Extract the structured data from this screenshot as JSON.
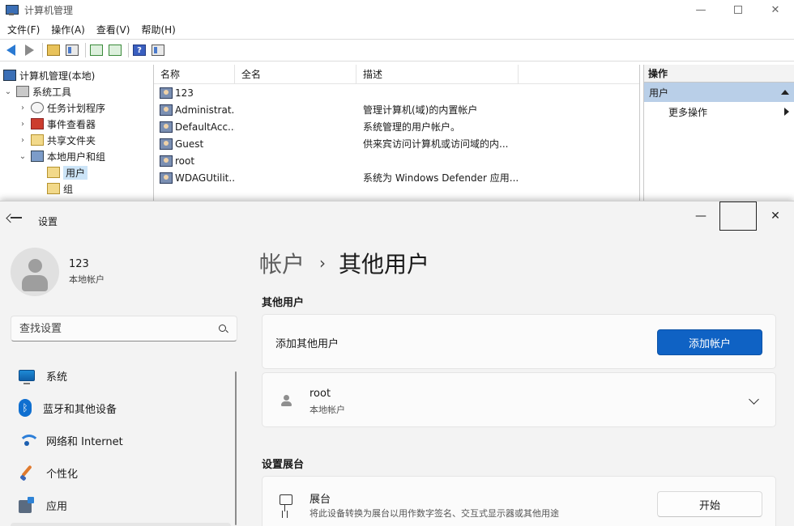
{
  "mmc": {
    "title": "计算机管理",
    "menu": [
      "文件(F)",
      "操作(A)",
      "查看(V)",
      "帮助(H)"
    ],
    "tree": [
      {
        "label": "计算机管理(本地)",
        "expander": "",
        "icon": "computer-icon"
      },
      {
        "label": "系统工具",
        "expander": "⌄",
        "icon": "tools-icon"
      },
      {
        "label": "任务计划程序",
        "expander": "›",
        "icon": "clock-icon"
      },
      {
        "label": "事件查看器",
        "expander": "›",
        "icon": "event-viewer-icon"
      },
      {
        "label": "共享文件夹",
        "expander": "›",
        "icon": "folder-icon"
      },
      {
        "label": "本地用户和组",
        "expander": "⌄",
        "icon": "users-icon"
      },
      {
        "label": "用户",
        "expander": "",
        "icon": "folder-icon"
      },
      {
        "label": "组",
        "expander": "",
        "icon": "folder-icon"
      }
    ],
    "columns": [
      "名称",
      "全名",
      "描述"
    ],
    "rows": [
      {
        "name": "123",
        "fullname": "",
        "desc": ""
      },
      {
        "name": "Administrat...",
        "fullname": "",
        "desc": "管理计算机(域)的内置帐户"
      },
      {
        "name": "DefaultAcc...",
        "fullname": "",
        "desc": "系统管理的用户帐户。"
      },
      {
        "name": "Guest",
        "fullname": "",
        "desc": "供来宾访问计算机或访问域的内..."
      },
      {
        "name": "root",
        "fullname": "",
        "desc": ""
      },
      {
        "name": "WDAGUtilit...",
        "fullname": "",
        "desc": "系统为 Windows Defender 应用..."
      }
    ],
    "actions": {
      "title": "操作",
      "selected": "用户",
      "more": "更多操作"
    }
  },
  "settings": {
    "title": "设置",
    "user": {
      "name": "123",
      "type": "本地帐户"
    },
    "search_placeholder": "查找设置",
    "nav": [
      {
        "label": "系统",
        "icon": "system-icon"
      },
      {
        "label": "蓝牙和其他设备",
        "icon": "bluetooth-icon"
      },
      {
        "label": "网络和 Internet",
        "icon": "wifi-icon"
      },
      {
        "label": "个性化",
        "icon": "brush-icon"
      },
      {
        "label": "应用",
        "icon": "apps-icon"
      }
    ],
    "breadcrumb": {
      "parent": "帐户",
      "separator": "›",
      "current": "其他用户"
    },
    "other_users": {
      "section_title": "其他用户",
      "add_label": "添加其他用户",
      "add_button": "添加帐户",
      "user": {
        "name": "root",
        "type": "本地帐户"
      }
    },
    "kiosk": {
      "section_title": "设置展台",
      "title": "展台",
      "desc": "将此设备转换为展台以用作数字签名、交互式显示器或其他用途",
      "button": "开始"
    }
  },
  "colors": {
    "accent": "#0f62c4",
    "selection": "#cce4f7"
  }
}
